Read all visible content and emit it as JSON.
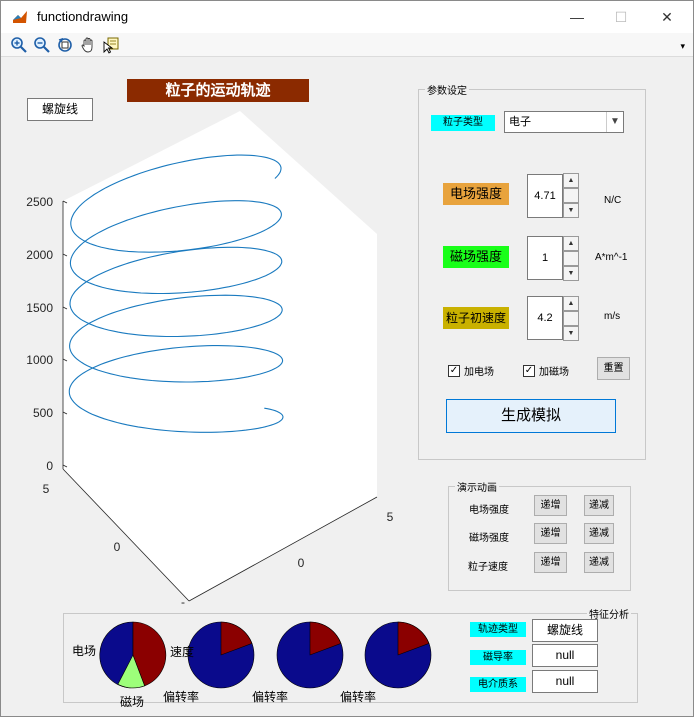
{
  "window": {
    "title": "functiondrawing",
    "minimize": "—",
    "maximize": "☐",
    "close": "✕"
  },
  "toolbar": {
    "icons": [
      "zoom-in-icon",
      "zoom-out-icon",
      "rotate-3d-icon",
      "pan-hand-icon",
      "data-cursor-icon"
    ],
    "overflow": "▾"
  },
  "plot": {
    "title": "粒子的运动轨迹",
    "mode_button": "螺旋线",
    "z_ticks": [
      "0",
      "500",
      "1000",
      "1500",
      "2000",
      "2500"
    ],
    "x_ticks": [
      "5",
      "0",
      "-"
    ],
    "y_ticks": [
      "5",
      "0"
    ]
  },
  "params": {
    "panel_title": "参数设定",
    "particle_type_label": "粒子类型",
    "particle_type_value": "电子",
    "e_field_label": "电场强度",
    "e_field_value": "4.71",
    "e_field_unit": "N/C",
    "b_field_label": "磁场强度",
    "b_field_value": "1",
    "b_field_unit": "A*m^-1",
    "v0_label": "粒子初速度",
    "v0_value": "4.2",
    "v0_unit": "m/s",
    "add_e_label": "加电场",
    "add_b_label": "加磁场",
    "reset_label": "重置",
    "generate_label": "生成模拟"
  },
  "animation": {
    "panel_title": "演示动画",
    "rows": [
      {
        "label": "电场强度",
        "inc": "递增",
        "dec": "递减"
      },
      {
        "label": "磁场强度",
        "inc": "递增",
        "dec": "递减"
      },
      {
        "label": "粒子速度",
        "inc": "递增",
        "dec": "递减"
      }
    ]
  },
  "features": {
    "panel_title": "特征分析",
    "track_type_label": "轨迹类型",
    "track_type_value": "螺旋线",
    "permeability_label": "磁导率",
    "permeability_value": "null",
    "dielectric_label": "电介质系",
    "dielectric_value": "null"
  },
  "pies": {
    "labels": {
      "electric": "电场",
      "speed": "速度",
      "magnetic": "磁场",
      "deflection": "偏转率"
    },
    "colors": {
      "blue": "#0a0a8c",
      "red": "#8b0000",
      "green": "#9dff7a"
    }
  },
  "colors": {
    "title_bg": "#8b2a00",
    "e_label_bg": "#e8a33d",
    "b_label_bg": "#19ff19",
    "v_label_bg": "#c9b100",
    "cyan": "#00ffff",
    "curve": "#1a7abf"
  }
}
